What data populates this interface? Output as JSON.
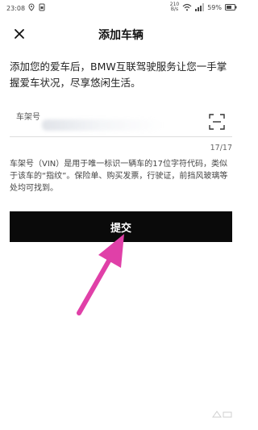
{
  "status_bar": {
    "time": "23:08",
    "net_speed_value": "210",
    "net_speed_unit": "B/s",
    "battery": "59%",
    "icons": [
      "location-icon",
      "sim-icon",
      "wifi-icon",
      "signal-icon",
      "battery-icon"
    ]
  },
  "header": {
    "title": "添加车辆",
    "close_icon": "close-icon"
  },
  "intro": {
    "text": "添加您的爱车后，BMW互联驾驶服务让您一手掌握爱车状况，尽享悠闲生活。"
  },
  "vin_field": {
    "label": "车架号",
    "value": "",
    "scan_icon": "scan-icon"
  },
  "char_count": "17/17",
  "vin_help": {
    "text": "车架号（VIN）是用于唯一标识一辆车的17位字符代码，类似于该车的“指纹”。保险单、购买发票，行驶证，前挡风玻璃等处均可找到。"
  },
  "submit": {
    "label": "提交"
  },
  "annotation": {
    "arrow_color": "#e040a8"
  }
}
